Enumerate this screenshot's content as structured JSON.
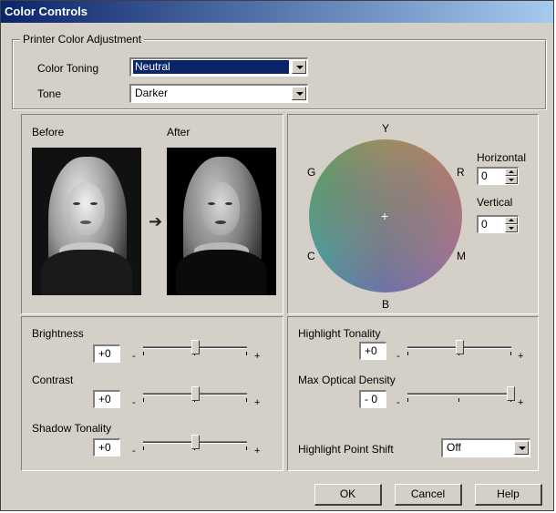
{
  "window": {
    "title": "Color Controls"
  },
  "printer_adjustment": {
    "group_label": "Printer Color Adjustment",
    "color_toning": {
      "label": "Color Toning",
      "value": "Neutral"
    },
    "tone": {
      "label": "Tone",
      "value": "Darker"
    }
  },
  "preview": {
    "before_label": "Before",
    "after_label": "After"
  },
  "color_wheel": {
    "labels": {
      "y": "Y",
      "r": "R",
      "m": "M",
      "b": "B",
      "c": "C",
      "g": "G"
    },
    "horizontal": {
      "label": "Horizontal",
      "value": "0"
    },
    "vertical": {
      "label": "Vertical",
      "value": "0"
    }
  },
  "sliders": {
    "brightness": {
      "label": "Brightness",
      "value": "+0",
      "level_percent": 50
    },
    "contrast": {
      "label": "Contrast",
      "value": "+0",
      "level_percent": 50
    },
    "shadow_tonality": {
      "label": "Shadow Tonality",
      "value": "+0",
      "level_percent": 50
    },
    "highlight_tonality": {
      "label": "Highlight Tonality",
      "value": "+0",
      "level_percent": 50
    },
    "max_optical_density": {
      "label": "Max Optical Density",
      "value": "- 0",
      "level_percent": 100
    },
    "minus_symbol": "-",
    "plus_symbol": "+"
  },
  "highlight_point_shift": {
    "label": "Highlight Point Shift",
    "value": "Off"
  },
  "buttons": {
    "ok": "OK",
    "cancel": "Cancel",
    "help": "Help"
  }
}
